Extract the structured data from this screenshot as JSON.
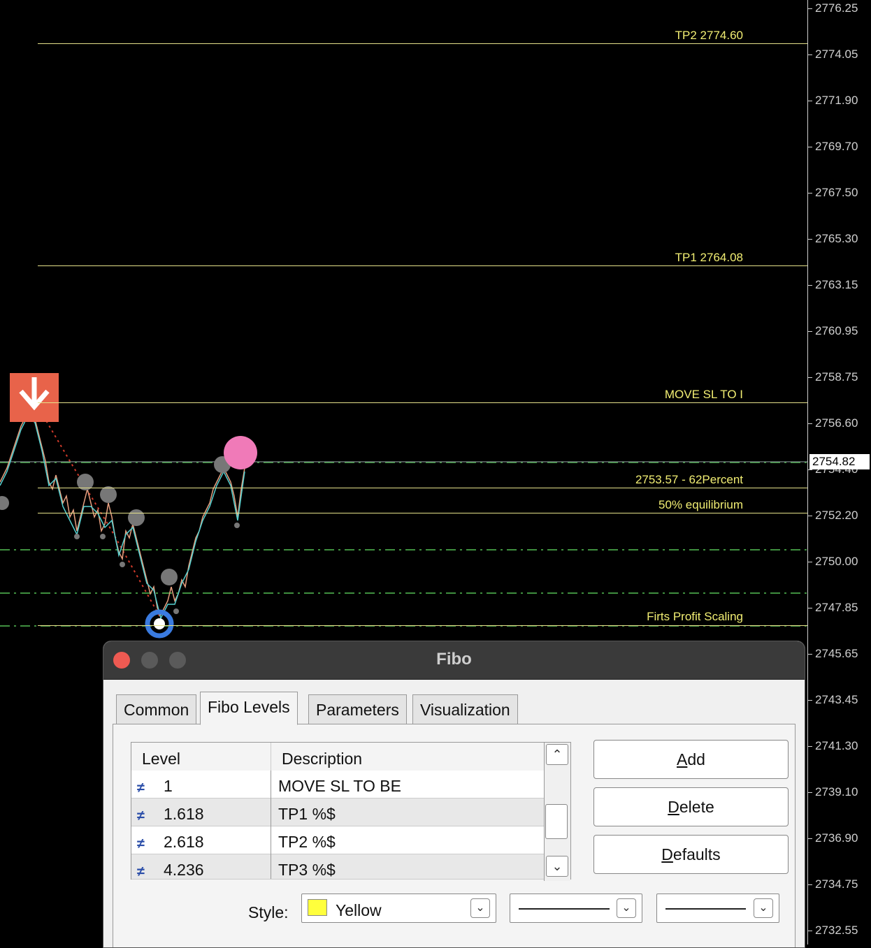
{
  "chart": {
    "current_price": "2754.82",
    "axis_ticks": [
      "2776.25",
      "2774.05",
      "2771.90",
      "2769.70",
      "2767.50",
      "2765.30",
      "2763.15",
      "2760.95",
      "2758.75",
      "2756.60",
      "2754.40",
      "2752.20",
      "2750.00",
      "2747.85",
      "2745.65",
      "2743.45",
      "2741.30",
      "2739.10",
      "2736.90",
      "2734.75",
      "2732.55"
    ],
    "levels": {
      "tp2": "TP2  2774.60",
      "tp1": "TP1  2764.08",
      "move_sl": "MOVE SL TO I",
      "pct62": "2753.57 - 62Percent",
      "equilibrium": "50% equilibrium",
      "first_profit": "Firts Profit Scaling"
    },
    "colors": {
      "level_line": "#e6e28a",
      "label": "#f2ee73",
      "dashed": "#3f8f3f",
      "sell_marker": "#e8634a",
      "pink_dot": "#f07ab8",
      "blue_ring": "#3a7be0"
    }
  },
  "dialog": {
    "title": "Fibo",
    "tabs": [
      "Common",
      "Fibo Levels",
      "Parameters",
      "Visualization"
    ],
    "active_tab": "Fibo Levels",
    "grid": {
      "headers": [
        "Level",
        "Description"
      ],
      "rows": [
        {
          "level": "1",
          "description": "MOVE SL TO BE"
        },
        {
          "level": "1.618",
          "description": "TP1  %$"
        },
        {
          "level": "2.618",
          "description": "TP2  %$"
        },
        {
          "level": "4.236",
          "description": "TP3  %$"
        }
      ]
    },
    "buttons": {
      "add": "Add",
      "delete": "Delete",
      "defaults": "Defaults"
    },
    "style": {
      "label": "Style:",
      "color_name": "Yellow",
      "color_hex": "#ffff3c"
    }
  }
}
